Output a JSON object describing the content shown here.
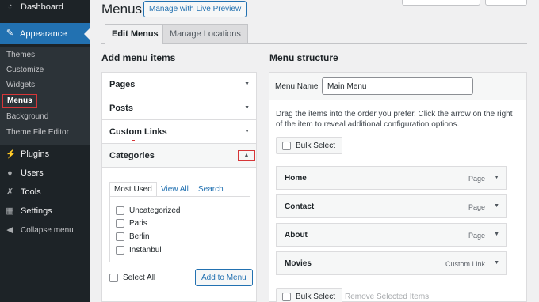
{
  "sidebar": {
    "dashboard": "Dashboard",
    "appearance": "Appearance",
    "submenu": [
      "Themes",
      "Customize",
      "Widgets",
      "Menus",
      "Background",
      "Theme File Editor"
    ],
    "plugins": "Plugins",
    "users": "Users",
    "tools": "Tools",
    "settings": "Settings",
    "collapse": "Collapse menu",
    "icons": [
      "gauge-icon",
      "paintbrush-icon",
      "plug-icon",
      "user-icon",
      "wrench-icon",
      "sliders-icon",
      "collapse-icon"
    ]
  },
  "header": {
    "title": "Menus",
    "live_preview": "Manage with Live Preview"
  },
  "tabs": [
    "Edit Menus",
    "Manage Locations"
  ],
  "left": {
    "heading": "Add menu items",
    "sections": [
      "Pages",
      "Posts",
      "Custom Links",
      "Categories"
    ],
    "cat_tabs": [
      "Most Used",
      "View All",
      "Search"
    ],
    "categories": [
      "Uncategorized",
      "Paris",
      "Berlin",
      "Instanbul"
    ],
    "select_all": "Select All",
    "add_button": "Add to Menu"
  },
  "right": {
    "heading": "Menu structure",
    "menu_name_label": "Menu Name",
    "menu_name_value": "Main Menu",
    "instructions": "Drag the items into the order you prefer. Click the arrow on the right of the item to reveal additional configuration options.",
    "bulk_select": "Bulk Select",
    "items": [
      {
        "title": "Home",
        "kind": "Page"
      },
      {
        "title": "Contact",
        "kind": "Page"
      },
      {
        "title": "About",
        "kind": "Page"
      },
      {
        "title": "Movies",
        "kind": "Custom Link"
      }
    ],
    "remove_selected": "Remove Selected Items"
  },
  "colors": {
    "sidebar": "#1d2327",
    "accent": "#2271b1",
    "highlight": "#d63638"
  }
}
